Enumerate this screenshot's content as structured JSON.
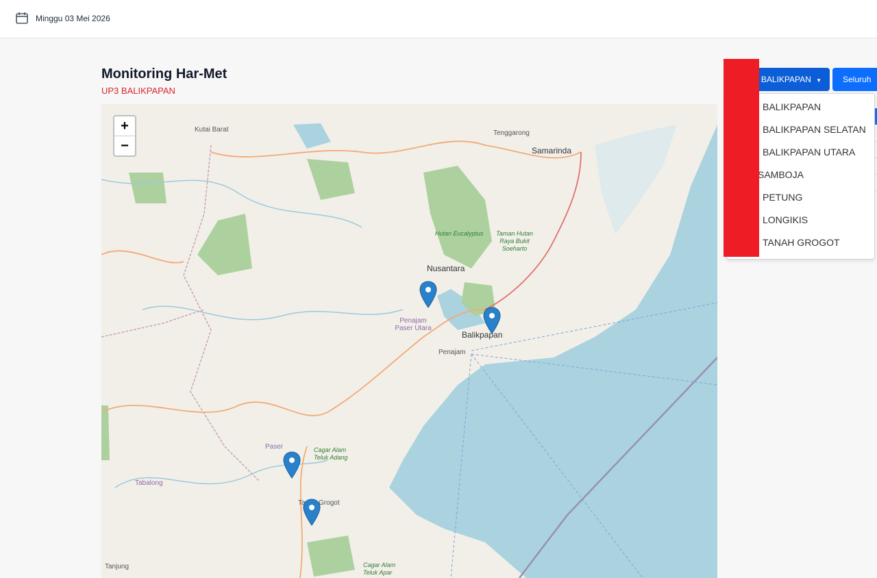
{
  "header": {
    "date": "Minggu 03 Mei 2026",
    "calendar_icon": "calendar-icon"
  },
  "page": {
    "title": "Monitoring Har-Met",
    "subtitle": "UP3 BALIKPAPAN"
  },
  "map": {
    "zoom_in": "+",
    "zoom_out": "−",
    "marker_icon": "map-marker-icon",
    "labels": {
      "kutai_barat": "Kutai Barat",
      "tenggarong": "Tenggarong",
      "samarinda": "Samarinda",
      "hutan_eucalyptus": "Hutan Eucalyptus",
      "taman_hutan": "Taman Hutan Raya Bukit Soeharto",
      "nusantara": "Nusantara",
      "penajam_paser_utara": "Penajam Paser Utara",
      "balikpapan": "Balikpapan",
      "penajam": "Penajam",
      "paser": "Paser",
      "cagar_alam_teluk_adang": "Cagar Alam Teluk Adang",
      "tabalong": "Tabalong",
      "tanah_grogot": "Tanah Grogot",
      "tanjung": "Tanjung",
      "cagar_alam_teluk_apar": "Cagar Alam Teluk Apar"
    }
  },
  "toolbar": {
    "dropdown_label": "BALIKPAPAN",
    "all_button": "Seluruh"
  },
  "dropdown": {
    "items": [
      "BALIKPAPAN",
      "BALIKPAPAN SELATAN",
      "BALIKPAPAN UTARA",
      "SAMBOJA",
      "PETUNG",
      "LONGIKIS",
      "TANAH GROGOT"
    ]
  },
  "colors": {
    "accent": "#0b5ed7",
    "subtitle": "#dc2626",
    "overlay": "#ee1c25",
    "sea": "#aad3df",
    "land": "#f2efe9",
    "forest": "#add19e",
    "marker": "#2a81cb"
  }
}
